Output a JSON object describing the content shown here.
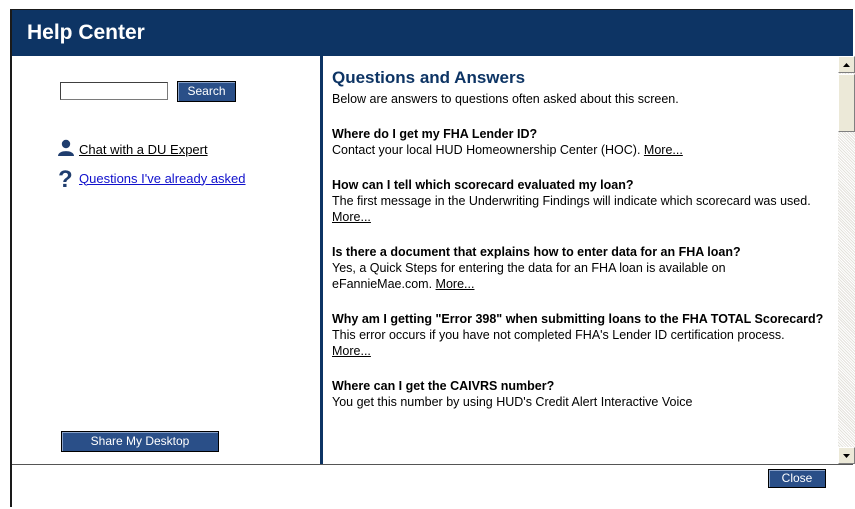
{
  "window": {
    "title": "Help Center"
  },
  "left": {
    "search": {
      "value": "",
      "button_label": "Search"
    },
    "links": [
      {
        "label": "Chat with a DU Expert",
        "icon": "person-icon"
      },
      {
        "label": "Questions I've already asked",
        "icon": "question-icon"
      }
    ],
    "share_label": "Share My Desktop"
  },
  "content": {
    "title": "Questions and Answers",
    "intro": "Below are answers to questions often asked about this screen.",
    "more_label": "More...",
    "items": [
      {
        "q": "Where do I get my FHA Lender ID?",
        "a": "Contact your local HUD Homeownership Center (HOC)."
      },
      {
        "q": "How can I tell which scorecard evaluated my loan?",
        "a": "The first message in the Underwriting Findings will indicate which scorecard was used."
      },
      {
        "q": "Is there a document that explains how to enter data for an FHA loan?",
        "a": "Yes, a Quick Steps for entering the data for an FHA loan is available on eFannieMae.com."
      },
      {
        "q": "Why am I getting \"Error 398\" when submitting loans to the FHA TOTAL Scorecard?",
        "a": "This error occurs if you have not completed FHA's Lender ID certification process."
      },
      {
        "q": "Where can I get the CAIVRS number?",
        "a": "You get this number by using HUD's Credit Alert Interactive Voice"
      }
    ]
  },
  "footer": {
    "close_label": "Close"
  },
  "colors": {
    "titlebar": "#0d3464",
    "button": "#2a4f88",
    "link": "#1010cc"
  }
}
